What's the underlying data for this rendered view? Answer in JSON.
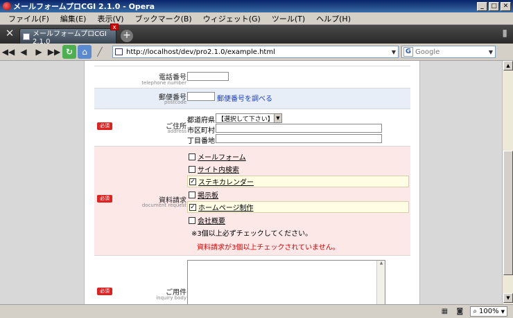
{
  "window": {
    "title": "メールフォームプロCGI 2.1.0 - Opera"
  },
  "menu": [
    "ファイル(F)",
    "編集(E)",
    "表示(V)",
    "ブックマーク(B)",
    "ウィジェット(G)",
    "ツール(T)",
    "ヘルプ(H)"
  ],
  "tab": {
    "label": "メールフォームプロCGI 2.1.0",
    "close": "x"
  },
  "address": {
    "url": "http://localhost/dev/pro2.1.0/example.html"
  },
  "search": {
    "placeholder": "Google"
  },
  "form": {
    "required_label": "必須",
    "phone": {
      "label": "電話番号",
      "sub": "telephone number"
    },
    "postal": {
      "label": "郵便番号",
      "sub": "postcode",
      "link": "郵便番号を調べる"
    },
    "address": {
      "label": "ご住所",
      "sub": "address",
      "prefecture_label": "都道府県",
      "prefecture_select": "【選択して下さい】",
      "city_label": "市区町村",
      "street_label": "丁目番地"
    },
    "materials": {
      "label": "資料請求",
      "sub": "document request",
      "options": [
        {
          "label": "メールフォーム",
          "checked": false
        },
        {
          "label": "サイト内検索",
          "checked": false
        },
        {
          "label": "ステキカレンダー",
          "checked": true
        },
        {
          "label": "掲示板",
          "checked": false
        },
        {
          "label": "ホームページ制作",
          "checked": true
        },
        {
          "label": "会社概要",
          "checked": false
        }
      ],
      "note": "※3個以上必ずチェックしてください。",
      "error": "資料請求が3個以上チェックされていません。"
    },
    "inquiry": {
      "label": "ご用件",
      "sub": "inquiry body"
    }
  },
  "status": {
    "zoom": "100%"
  }
}
